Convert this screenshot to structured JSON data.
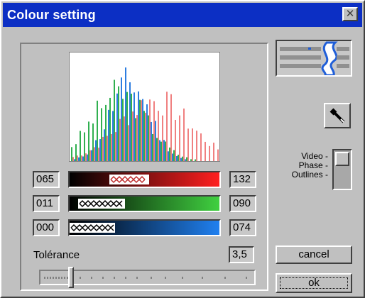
{
  "window": {
    "title": "Colour setting",
    "close_icon": "close-icon"
  },
  "channels": [
    {
      "name": "red",
      "min": "065",
      "max": "132",
      "color": "#e02020"
    },
    {
      "name": "green",
      "min": "011",
      "max": "090",
      "color": "#2aa02a"
    },
    {
      "name": "blue",
      "min": "000",
      "max": "074",
      "color": "#1f5ed8"
    }
  ],
  "tolerance": {
    "label": "Tolérance",
    "value": "3,5"
  },
  "modes": {
    "video": "Video -",
    "phase": "Phase -",
    "outlines": "Outlines -"
  },
  "buttons": {
    "cancel": "cancel",
    "ok": "ok"
  },
  "icons": {
    "picker": "eyedropper-icon",
    "preview": "edge-preview-icon"
  }
}
